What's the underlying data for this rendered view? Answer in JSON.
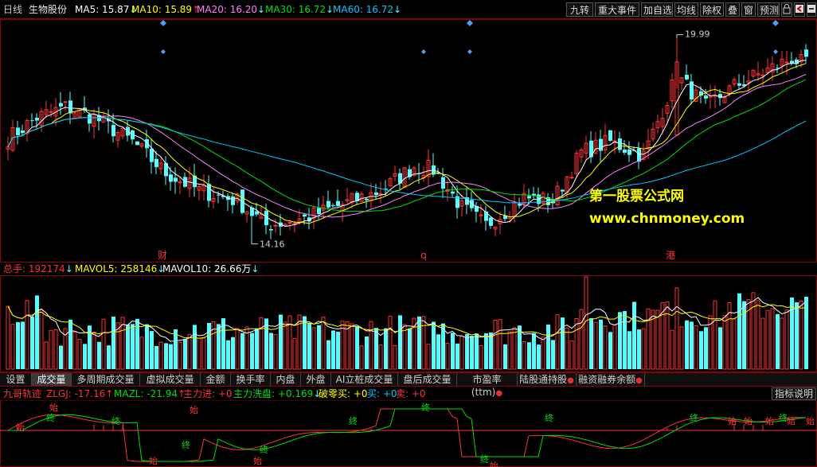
{
  "header": {
    "period": "日线",
    "stock": "生物股份",
    "ma5": {
      "label": "MA5: 15.87",
      "arrow": "↓"
    },
    "ma10": {
      "label": "MA10: 15.89",
      "arrow": "↑"
    },
    "ma20": {
      "label": "MA20: 16.20",
      "arrow": "↓"
    },
    "ma30": {
      "label": "MA30: 16.72",
      "arrow": "↓"
    },
    "ma60": {
      "label": "MA60: 16.72",
      "arrow": "↓"
    },
    "buttons": [
      "九转",
      "重大事件",
      "加自选",
      "均线",
      "除权",
      "叠",
      "窗",
      "预测"
    ]
  },
  "price_chart": {
    "high_marker": "19.99",
    "low_marker": "14.16",
    "event_labels": [
      "财",
      "q",
      "港"
    ]
  },
  "watermark": {
    "line1": "第一股票公式网",
    "line2": "www.chnmoney.com"
  },
  "volume": {
    "total": {
      "label": "总手:",
      "value": "192174",
      "arrow": "↓"
    },
    "mavol5": {
      "label": "MAVOL5: 258146",
      "arrow": "↓"
    },
    "mavol10": {
      "label": "MAVOL10: 26.66万",
      "arrow": "↓"
    }
  },
  "tabs": [
    "设置",
    "成交量",
    "多周期成交量",
    "虚拟成交量",
    "金额",
    "换手率",
    "内盘",
    "外盘",
    "AI立桩成交量",
    "盘后成交量",
    "市盈率(ttm)",
    "陆股通持股",
    "融资融券余额"
  ],
  "indicator": {
    "name": "九哥轨迹",
    "zlgj": {
      "label": "ZLGJ: -17.16",
      "arrow": "↑"
    },
    "mazl": {
      "label": "MAZL: -21.94",
      "arrow": "↑"
    },
    "inflow": "主力进: +0",
    "wash": {
      "label": "主力洗盘: +0.169",
      "arrow": "↓"
    },
    "breakzero": "破零买: +0",
    "buy": "买: +0",
    "sell": "卖: +0",
    "explain_button": "指标说明",
    "marks": [
      "始",
      "终"
    ]
  },
  "colors": {
    "up": "#ff3232",
    "down": "#54ffff",
    "ma5": "#ffffff",
    "ma10": "#ffff00",
    "ma20": "#ff80ff",
    "ma30": "#00e000",
    "ma60": "#00c8ff",
    "grid_border": "#8b0000",
    "watermark_yellow": "#ffff00"
  }
}
